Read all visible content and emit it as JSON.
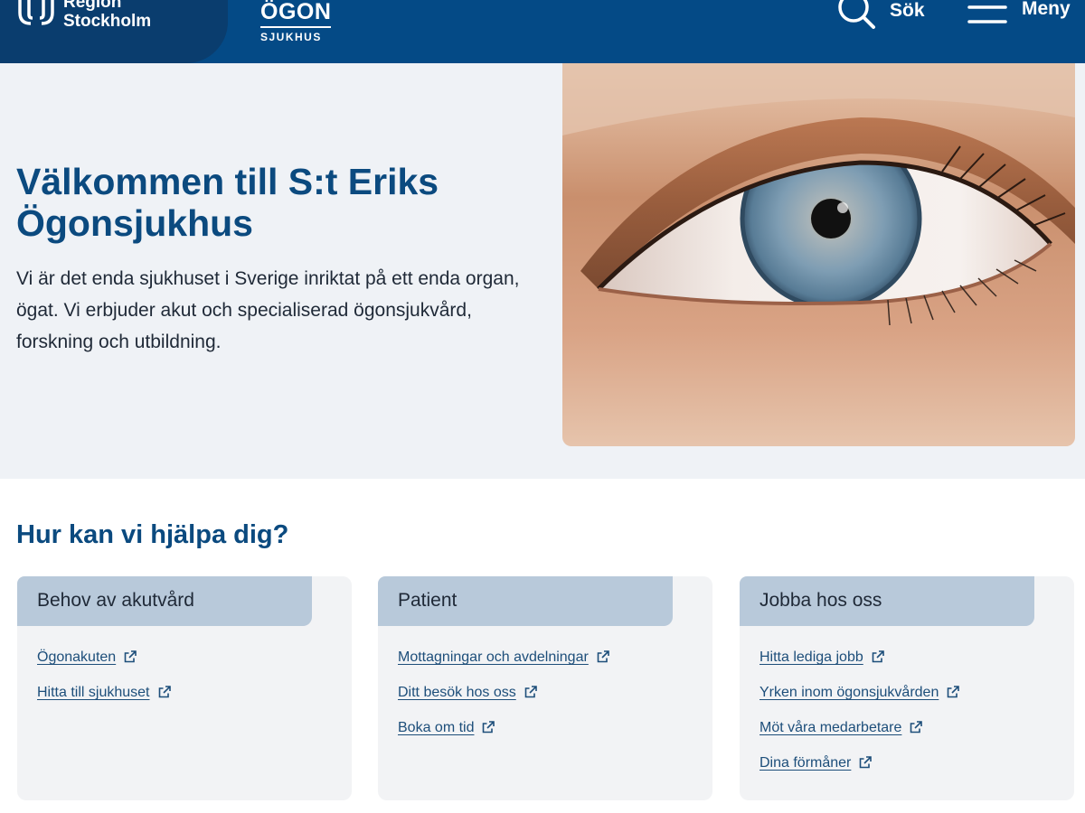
{
  "header": {
    "logo_line1": "Region",
    "logo_line2": "Stockholm",
    "brand_top": "ÖGON",
    "brand_bottom": "SJUKHUS",
    "search_label": "Sök",
    "menu_label": "Meny",
    "colors": {
      "bar": "#044a86",
      "logo_block": "#0a3d6e"
    }
  },
  "hero": {
    "title": "Välkommen till S:t Eriks Ögonsjukhus",
    "text": "Vi är det enda sjukhuset i Sverige inriktat på ett enda organ, ögat. Vi erbjuder akut och specialiserad ögonsjukvård, forskning och utbildning."
  },
  "help": {
    "title": "Hur kan vi hjälpa dig?",
    "cards": [
      {
        "title": "Behov av akutvård",
        "links": [
          "Ögonakuten",
          "Hitta till sjukhuset"
        ]
      },
      {
        "title": "Patient",
        "links": [
          "Mottagningar och avdelningar",
          "Ditt besök hos oss",
          "Boka om tid"
        ]
      },
      {
        "title": "Jobba hos oss",
        "links": [
          "Hitta lediga jobb",
          "Yrken inom ögonsjukvården",
          "Möt våra medarbetare",
          "Dina förmåner"
        ]
      }
    ]
  },
  "icons": {
    "search": "search-icon",
    "menu": "hamburger-menu-icon",
    "external": "external-link-icon"
  }
}
